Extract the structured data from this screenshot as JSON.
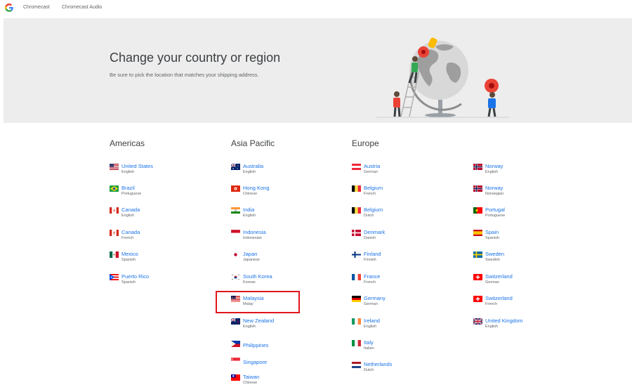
{
  "nav": {
    "logo": "google-logo",
    "links": [
      "Chromecast",
      "Chromecast Audio"
    ]
  },
  "hero": {
    "title": "Change your country or region",
    "subtitle": "Be sure to pick the location that matches your shipping address."
  },
  "columns": [
    {
      "heading": "Americas",
      "items": [
        {
          "name": "United States",
          "lang": "English",
          "flag": "us"
        },
        {
          "name": "Brazil",
          "lang": "Portuguese",
          "flag": "br"
        },
        {
          "name": "Canada",
          "lang": "English",
          "flag": "ca"
        },
        {
          "name": "Canada",
          "lang": "French",
          "flag": "ca"
        },
        {
          "name": "Mexico",
          "lang": "Spanish",
          "flag": "mx"
        },
        {
          "name": "Puerto Rico",
          "lang": "Spanish",
          "flag": "pr"
        }
      ]
    },
    {
      "heading": "Asia Pacific",
      "items": [
        {
          "name": "Australia",
          "lang": "English",
          "flag": "au"
        },
        {
          "name": "Hong Kong",
          "lang": "Chinese",
          "flag": "hk"
        },
        {
          "name": "India",
          "lang": "English",
          "flag": "in"
        },
        {
          "name": "Indonesia",
          "lang": "Indonesian",
          "flag": "id"
        },
        {
          "name": "Japan",
          "lang": "Japanese",
          "flag": "jp"
        },
        {
          "name": "South Korea",
          "lang": "Korean",
          "flag": "kr"
        },
        {
          "name": "Malaysia",
          "lang": "Malay",
          "flag": "my"
        },
        {
          "name": "New Zealand",
          "lang": "English",
          "flag": "nz"
        },
        {
          "name": "Philippines",
          "lang": "",
          "flag": "ph"
        },
        {
          "name": "Singapore",
          "lang": "",
          "flag": "sg"
        },
        {
          "name": "Taiwan",
          "lang": "Chinese",
          "flag": "tw"
        }
      ]
    },
    {
      "heading": "Europe",
      "items": [
        {
          "name": "Austria",
          "lang": "German",
          "flag": "at"
        },
        {
          "name": "Belgium",
          "lang": "French",
          "flag": "be"
        },
        {
          "name": "Belgium",
          "lang": "Dutch",
          "flag": "be"
        },
        {
          "name": "Denmark",
          "lang": "Danish",
          "flag": "dk"
        },
        {
          "name": "Finland",
          "lang": "Finnish",
          "flag": "fi"
        },
        {
          "name": "France",
          "lang": "French",
          "flag": "fr"
        },
        {
          "name": "Germany",
          "lang": "German",
          "flag": "de"
        },
        {
          "name": "Ireland",
          "lang": "English",
          "flag": "ie"
        },
        {
          "name": "Italy",
          "lang": "Italian",
          "flag": "it"
        },
        {
          "name": "Netherlands",
          "lang": "Dutch",
          "flag": "nl"
        }
      ]
    },
    {
      "heading": "",
      "items": [
        {
          "name": "Norway",
          "lang": "English",
          "flag": "no"
        },
        {
          "name": "Norway",
          "lang": "Norwegian",
          "flag": "no"
        },
        {
          "name": "Portugal",
          "lang": "Portuguese",
          "flag": "pt"
        },
        {
          "name": "Spain",
          "lang": "Spanish",
          "flag": "es"
        },
        {
          "name": "Sweden",
          "lang": "Swedish",
          "flag": "se"
        },
        {
          "name": "Switzerland",
          "lang": "German",
          "flag": "ch"
        },
        {
          "name": "Switzerland",
          "lang": "French",
          "flag": "ch"
        },
        {
          "name": "United Kingdom",
          "lang": "English",
          "flag": "gb"
        }
      ]
    }
  ],
  "highlighted_item": "Malaysia",
  "colors": {
    "link": "#1a73e8",
    "hero_bg": "#ededed",
    "highlight": "#e0161c"
  }
}
